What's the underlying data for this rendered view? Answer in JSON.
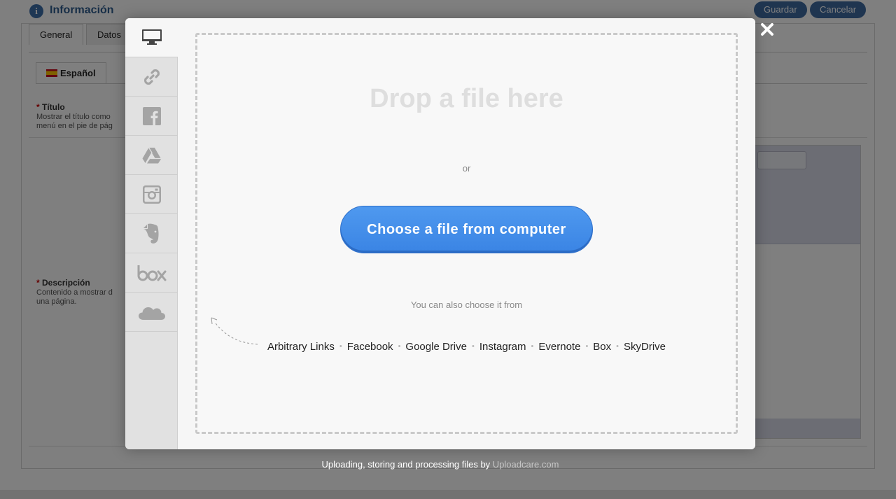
{
  "background": {
    "header_title": "Información",
    "save_label": "Guardar",
    "cancel_label": "Cancelar",
    "tabs": [
      {
        "label": "General"
      },
      {
        "label": "Datos"
      }
    ],
    "language_tab": "Español",
    "title_field": {
      "required_mark": "*",
      "label": "Título",
      "help_line1": "Mostrar el título como",
      "help_line2": "menú en el pie de pág"
    },
    "description_field": {
      "required_mark": "*",
      "label": "Descripción",
      "help_line1": "Contenido a mostrar d",
      "help_line2": "una página."
    }
  },
  "dialog": {
    "tabs": [
      {
        "icon": "computer-icon",
        "active": true
      },
      {
        "icon": "link-icon"
      },
      {
        "icon": "facebook-icon"
      },
      {
        "icon": "google-drive-icon"
      },
      {
        "icon": "instagram-icon"
      },
      {
        "icon": "evernote-icon"
      },
      {
        "icon": "box-icon"
      },
      {
        "icon": "skydrive-icon"
      }
    ],
    "drop_title": "Drop a file here",
    "or_text": "or",
    "choose_button": "Choose a file from computer",
    "also_text": "You can also choose it from",
    "sources": [
      "Arbitrary Links",
      "Facebook",
      "Google Drive",
      "Instagram",
      "Evernote",
      "Box",
      "SkyDrive"
    ],
    "close_icon": "close-icon"
  },
  "footer": {
    "text": "Uploading, storing and processing files by ",
    "link": "Uploadcare.com"
  },
  "colors": {
    "accent": "#3a84e4",
    "tab_bg": "#e1e1e1",
    "panel_bg": "#f6f6f6"
  }
}
